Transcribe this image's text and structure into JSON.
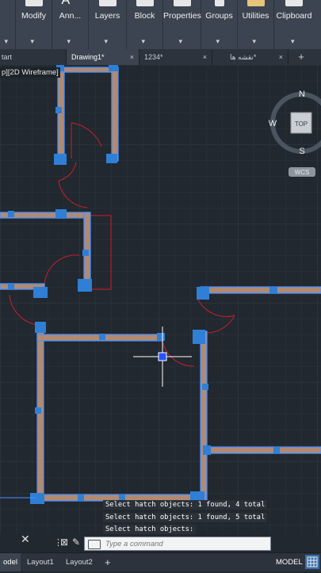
{
  "ribbon": {
    "groups": [
      {
        "label": "Modify",
        "icon": "move-icon"
      },
      {
        "label": "Ann...",
        "icon": "text-icon"
      },
      {
        "label": "Layers",
        "icon": "layers-icon"
      },
      {
        "label": "Block",
        "icon": "block-icon"
      },
      {
        "label": "Properties",
        "icon": "properties-icon"
      },
      {
        "label": "Groups",
        "icon": "groups-icon"
      },
      {
        "label": "Utilities",
        "icon": "utilities-icon"
      },
      {
        "label": "Clipboard",
        "icon": "clipboard-icon"
      }
    ]
  },
  "tabs": [
    {
      "label": "tart",
      "active": false
    },
    {
      "label": "Drawing1*",
      "active": true,
      "close": "×"
    },
    {
      "label": "1234*",
      "active": false,
      "close": "×"
    },
    {
      "label": "نقشه ها*",
      "active": false,
      "close": "×"
    }
  ],
  "viewport_label": "p][2D Wireframe]",
  "viewcube": {
    "north": "N",
    "south": "S",
    "west": "W",
    "face": "TOP",
    "wcs": "WCS"
  },
  "command_history": [
    "Select hatch objects: 1 found, 4 total",
    "Select hatch objects: 1 found, 5 total",
    "Select hatch objects:"
  ],
  "command_line": {
    "placeholder": "Type a command"
  },
  "status": {
    "layout_tabs": [
      "odel",
      "Layout1",
      "Layout2"
    ],
    "model_button": "MODEL"
  },
  "colors": {
    "background": "#212830",
    "wall_fill": "#b08a72",
    "wall_selected_edge": "#4a90ff",
    "grip": "#2f7fd6",
    "door_arc": "#b0202a"
  }
}
